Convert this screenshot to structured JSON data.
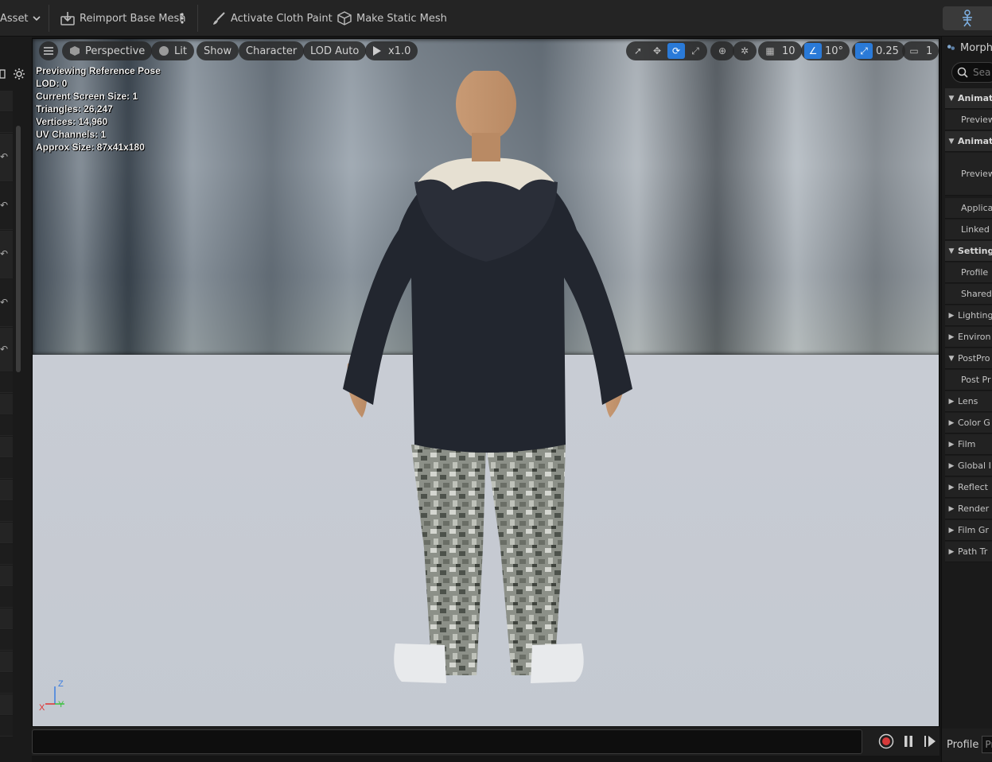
{
  "toolbar": {
    "asset_label": "Asset",
    "reimport_label": "Reimport Base Mesh",
    "cloth_paint_label": "Activate Cloth Paint",
    "static_mesh_label": "Make Static Mesh"
  },
  "viewport": {
    "perspective_label": "Perspective",
    "lit_label": "Lit",
    "show_label": "Show",
    "character_label": "Character",
    "lod_label": "LOD Auto",
    "speed_label": "x1.0",
    "grid_snap_value": "10",
    "rotation_snap_value": "10°",
    "scale_snap_value": "0.25",
    "camera_speed_value": "1",
    "stats": [
      "Previewing Reference Pose",
      "LOD: 0",
      "Current Screen Size: 1",
      "Triangles: 26,247",
      "Vertices: 14,960",
      "UV Channels: 1",
      "Approx Size: 87x41x180"
    ],
    "axis": {
      "z": "Z",
      "x": "X",
      "y": "Y"
    }
  },
  "right_panel": {
    "tab_label": "Morph",
    "search_placeholder": "Sea",
    "rows": [
      {
        "label": "Animat",
        "kind": "category",
        "expanded": true
      },
      {
        "label": "Preview",
        "kind": "item"
      },
      {
        "label": "Animat",
        "kind": "category",
        "expanded": true
      },
      {
        "label": "Preview",
        "kind": "item-tall"
      },
      {
        "label": "Applica",
        "kind": "item"
      },
      {
        "label": "Linked",
        "kind": "item"
      },
      {
        "label": "Setting",
        "kind": "category",
        "expanded": true
      },
      {
        "label": "Profile",
        "kind": "item"
      },
      {
        "label": "Shared",
        "kind": "item"
      },
      {
        "label": "Lighting",
        "kind": "collapsed"
      },
      {
        "label": "Environ",
        "kind": "collapsed"
      },
      {
        "label": "PostPro",
        "kind": "expanded"
      },
      {
        "label": "Post Pr",
        "kind": "item"
      },
      {
        "label": "Lens",
        "kind": "collapsed"
      },
      {
        "label": "Color G",
        "kind": "collapsed"
      },
      {
        "label": "Film",
        "kind": "collapsed"
      },
      {
        "label": "Global I",
        "kind": "collapsed"
      },
      {
        "label": "Reflect",
        "kind": "collapsed"
      },
      {
        "label": "Render",
        "kind": "collapsed"
      },
      {
        "label": "Film Gr",
        "kind": "collapsed"
      },
      {
        "label": "Path Tr",
        "kind": "collapsed"
      }
    ],
    "profile_label": "Profile",
    "profile_value": "Pr"
  },
  "colors": {
    "accent": "#2a7ad8",
    "record": "#d63a3a"
  }
}
